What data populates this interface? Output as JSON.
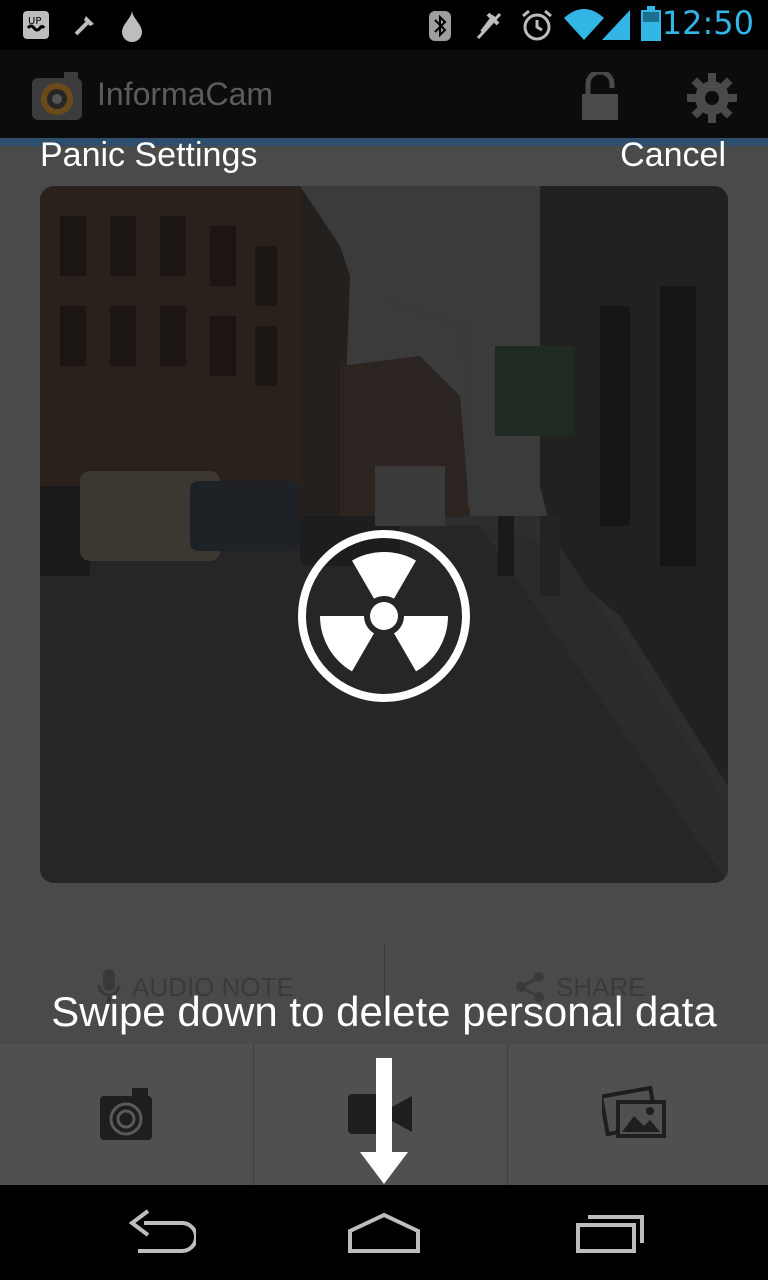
{
  "status_bar": {
    "time": "12:50",
    "left_icons": [
      "voicemail-icon",
      "tools-icon",
      "droplet-icon"
    ],
    "right_icons": [
      "bluetooth-icon",
      "mute-icon",
      "alarm-icon",
      "wifi-icon",
      "signal-icon",
      "battery-icon"
    ],
    "accent_color": "#33b5e5"
  },
  "action_bar": {
    "app_title": "InformaCam",
    "icons": [
      "app-logo-icon",
      "lock-icon",
      "gear-icon"
    ]
  },
  "overlay": {
    "header_left": "Panic Settings",
    "header_right": "Cancel",
    "center_icon": "radiation-icon",
    "swipe_hint": "Swipe down to delete personal data",
    "arrow_icon": "arrow-down-icon"
  },
  "actions": {
    "audio_note": "AUDIO NOTE",
    "share": "SHARE"
  },
  "tabs": [
    {
      "icon": "camera-icon"
    },
    {
      "icon": "video-camera-icon"
    },
    {
      "icon": "gallery-icon"
    }
  ],
  "nav_bar": [
    "back-icon",
    "home-icon",
    "recent-apps-icon"
  ]
}
